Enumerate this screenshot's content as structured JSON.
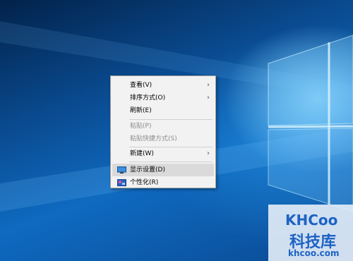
{
  "context_menu": {
    "items": [
      {
        "label": "查看(V)",
        "submenu": true,
        "disabled": false
      },
      {
        "label": "排序方式(O)",
        "submenu": true,
        "disabled": false
      },
      {
        "label": "刷新(E)",
        "submenu": false,
        "disabled": false
      },
      {
        "label": "粘贴(P)",
        "submenu": false,
        "disabled": true
      },
      {
        "label": "粘贴快捷方式(S)",
        "submenu": false,
        "disabled": true
      },
      {
        "label": "新建(W)",
        "submenu": true,
        "disabled": false
      },
      {
        "label": "显示设置(D)",
        "submenu": false,
        "disabled": false,
        "icon": "display-icon",
        "highlighted": true
      },
      {
        "label": "个性化(R)",
        "submenu": false,
        "disabled": false,
        "icon": "personalize-icon"
      }
    ]
  },
  "watermark": {
    "brand": "KHCoo",
    "name": "科技库",
    "domain": "khcoo.com"
  },
  "colors": {
    "menu_bg": "#f2f2f2",
    "highlight": "#dadada",
    "disabled_text": "#8d8d8d",
    "desktop_blue": "#0f6ac0",
    "watermark_blue": "#1e63c4"
  }
}
